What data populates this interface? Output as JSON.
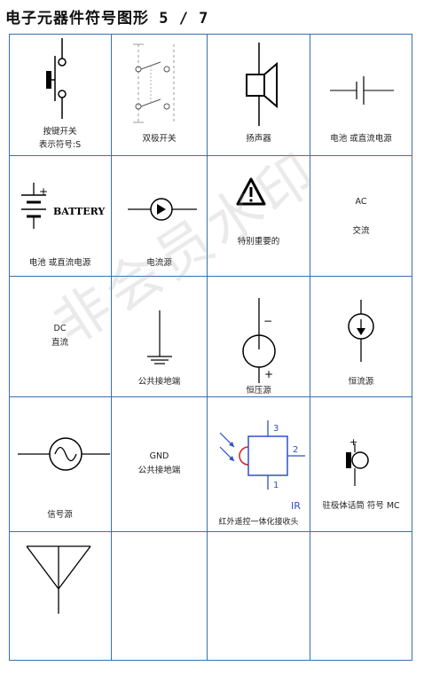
{
  "page_title": "电子元器件符号图形 5 / 7",
  "watermark": "非会员水印",
  "cells": [
    {
      "label": "按键开关",
      "label2": "表示符号:S",
      "icon": "push-button-switch-icon"
    },
    {
      "label": "双极开关",
      "icon": "double-pole-switch-icon"
    },
    {
      "label": "扬声器",
      "icon": "speaker-icon"
    },
    {
      "label": "电池 或直流电源",
      "icon": "battery-cell-icon"
    },
    {
      "label": "电池 或直流电源",
      "icon": "battery-icon",
      "text": "BATTERY",
      "plus": "+"
    },
    {
      "label": "电流源",
      "icon": "current-source-icon"
    },
    {
      "label": "特别重要的",
      "icon": "warning-triangle-icon"
    },
    {
      "label": "AC",
      "label2": "交流"
    },
    {
      "label": "DC",
      "label2": "直流"
    },
    {
      "label": "公共接地端",
      "icon": "ground-icon"
    },
    {
      "label": "恒压源",
      "icon": "voltage-source-icon",
      "minus": "−",
      "plus": "+"
    },
    {
      "label": "恒流源",
      "icon": "constant-current-source-icon"
    },
    {
      "label": "信号源",
      "icon": "signal-source-icon"
    },
    {
      "label": "GND",
      "label2": "公共接地端"
    },
    {
      "label": "红外遥控一体化接收头",
      "icon": "ir-receiver-icon",
      "pin1": "1",
      "pin2": "2",
      "pin3": "3",
      "tag": "IR"
    },
    {
      "label": "驻极体话筒 符号 MC",
      "icon": "electret-microphone-icon",
      "plus": "+"
    },
    {
      "icon": "antenna-icon"
    }
  ]
}
